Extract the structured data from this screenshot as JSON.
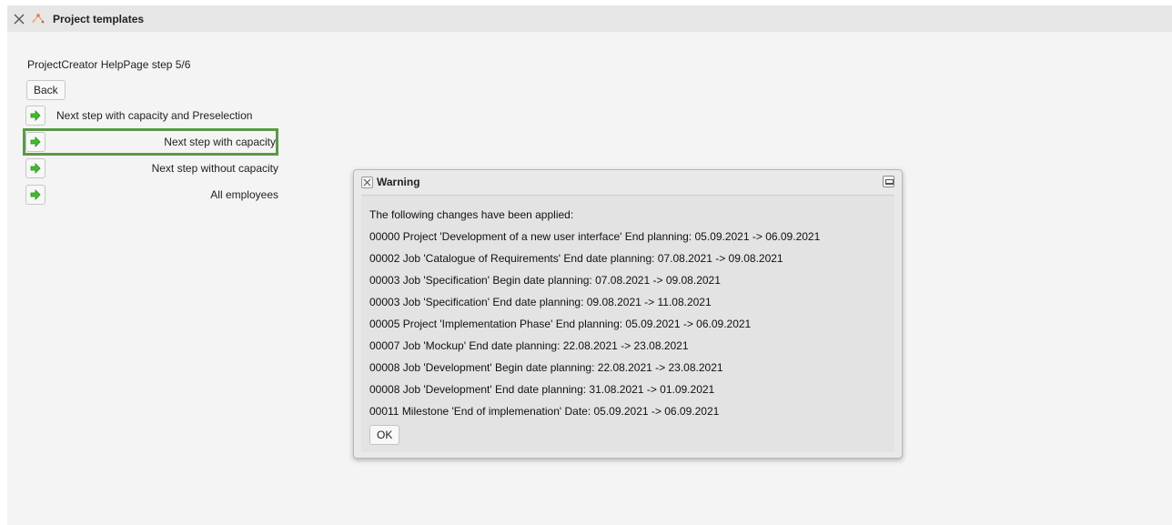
{
  "window": {
    "title": "Project templates",
    "icons": {
      "close": "close-icon",
      "logo": "app-logo-icon"
    }
  },
  "page": {
    "step_title": "ProjectCreator HelpPage step 5/6",
    "back_label": "Back"
  },
  "steps": [
    {
      "label": "Next step with capacity and Preselection",
      "icon": "arrow-right-icon",
      "selected": false
    },
    {
      "label": "Next step with capacity",
      "icon": "arrow-right-icon",
      "selected": true
    },
    {
      "label": "Next step without capacity",
      "icon": "arrow-right-icon",
      "selected": false
    },
    {
      "label": "All employees",
      "icon": "arrow-right-icon",
      "selected": false
    }
  ],
  "dialog": {
    "title": "Warning",
    "icons": {
      "close": "close-icon",
      "maximize": "maximize-icon"
    },
    "lines": [
      "The following changes have been applied:",
      "00000 Project 'Development of a new user interface' End planning: 05.09.2021 -> 06.09.2021",
      "00002 Job 'Catalogue of Requirements' End date planning: 07.08.2021 -> 09.08.2021",
      "00003 Job 'Specification' Begin date planning: 07.08.2021 -> 09.08.2021",
      "00003 Job 'Specification' End date planning: 09.08.2021 -> 11.08.2021",
      "00005 Project 'Implementation Phase' End planning: 05.09.2021 -> 06.09.2021",
      "00007 Job 'Mockup' End date planning: 22.08.2021 -> 23.08.2021",
      "00008 Job 'Development' Begin date planning: 22.08.2021 -> 23.08.2021",
      "00008 Job 'Development' End date planning: 31.08.2021 -> 01.09.2021",
      "00011 Milestone 'End of implemenation' Date: 05.09.2021 -> 06.09.2021"
    ],
    "ok_label": "OK"
  },
  "colors": {
    "selection_border": "#5a9a45",
    "arrow_green": "#3fbf2a",
    "titlebar_bg": "#e6e6e6",
    "dialog_bg": "#e3e3e3"
  }
}
